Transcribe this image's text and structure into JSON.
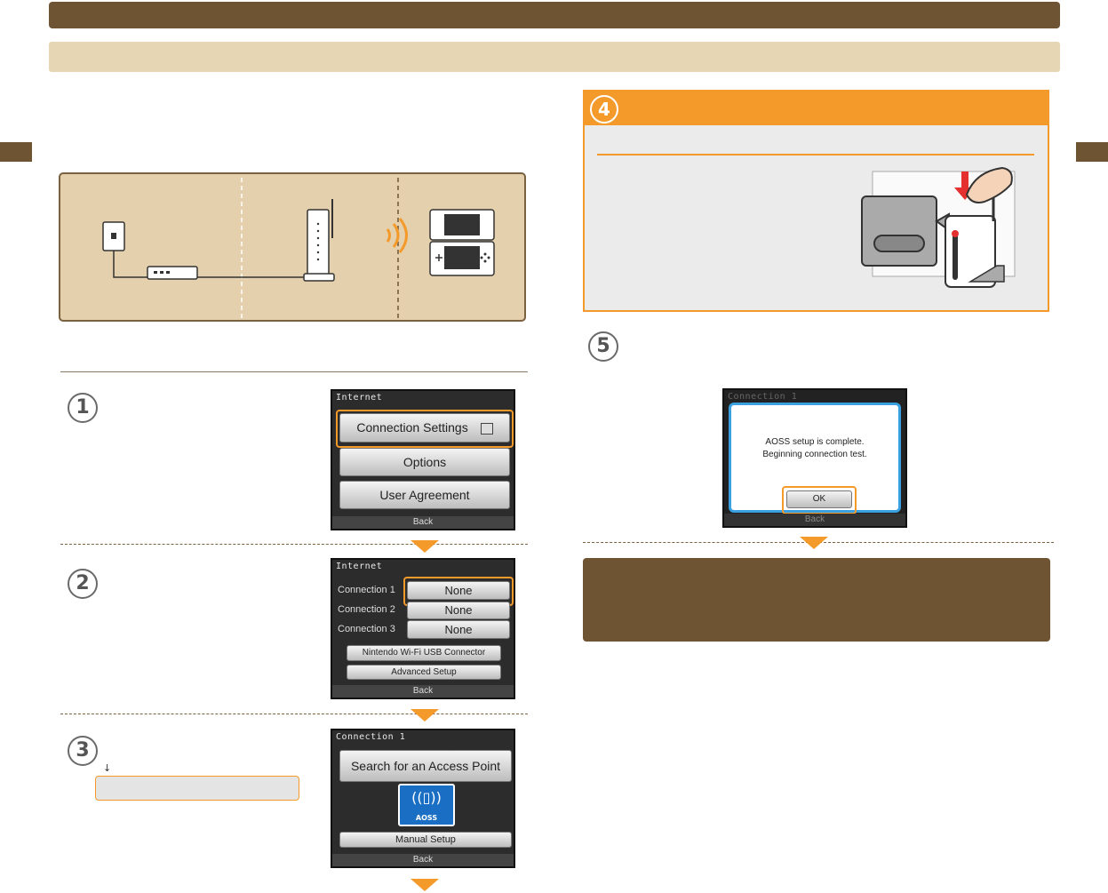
{
  "colors": {
    "brown": "#6e5433",
    "tan": "#e6d6b4",
    "orange": "#f39a2b",
    "grey": "#ebebeb"
  },
  "steps": {
    "one": "1",
    "two": "2",
    "three": "3",
    "four": "4",
    "five": "5"
  },
  "step3_arrow": "↓",
  "screens": {
    "internet": {
      "header": "Internet",
      "connection_settings": "Connection Settings",
      "options": "Options",
      "user_agreement": "User Agreement",
      "back": "Back"
    },
    "internet_connections": {
      "header": "Internet",
      "connection1_label": "Connection 1",
      "connection2_label": "Connection 2",
      "connection3_label": "Connection 3",
      "connection1_value": "None",
      "connection2_value": "None",
      "connection3_value": "None",
      "usb_connector": "Nintendo Wi-Fi USB Connector",
      "advanced_setup": "Advanced Setup",
      "back": "Back"
    },
    "connection1": {
      "header": "Connection 1",
      "search": "Search for an Access Point",
      "aoss_logo": "AOSS",
      "manual_setup": "Manual Setup",
      "back": "Back"
    },
    "aoss_complete": {
      "header": "Connection 1",
      "message_line1": "AOSS setup is complete.",
      "message_line2": "Beginning connection test.",
      "ok": "OK",
      "back": "Back"
    }
  }
}
